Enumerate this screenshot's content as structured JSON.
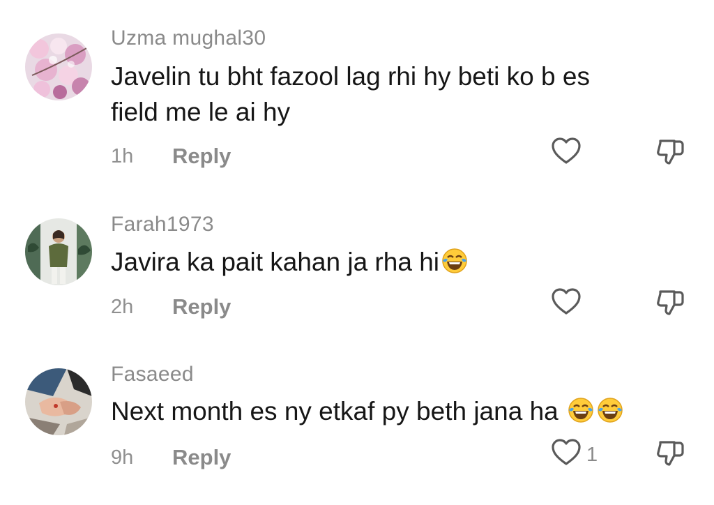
{
  "comments": [
    {
      "username": "Uzma mughal30",
      "text_lines": [
        "Javelin tu bht fazool lag rhi hy beti ko b es",
        "field me le ai hy"
      ],
      "emojis": [],
      "time": "1h",
      "reply_label": "Reply",
      "like_count": "",
      "avatar_icon": "cherry-blossom-avatar"
    },
    {
      "username": "Farah1973",
      "text_lines": [
        "Javira ka pait kahan ja rha hi"
      ],
      "emojis": [
        "face-with-tears-of-joy"
      ],
      "time": "2h",
      "reply_label": "Reply",
      "like_count": "",
      "avatar_icon": "person-photo-avatar"
    },
    {
      "username": "Fasaeed",
      "text_lines": [
        "Next month es ny etkaf py beth jana ha "
      ],
      "emojis": [
        "face-with-tears-of-joy",
        "face-with-tears-of-joy"
      ],
      "time": "9h",
      "reply_label": "Reply",
      "like_count": "1",
      "avatar_icon": "holding-hands-avatar"
    }
  ],
  "icons": {
    "like": "heart-outline-icon",
    "dislike": "thumbs-down-outline-icon"
  },
  "colors": {
    "username": "#8a8a8a",
    "text": "#161616",
    "meta": "#8f8f8f",
    "icon_stroke": "#5a5a5a"
  }
}
